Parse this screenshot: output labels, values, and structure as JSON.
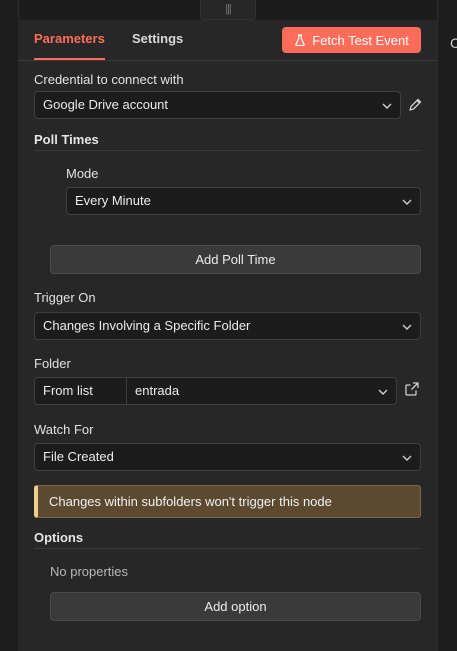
{
  "tabs": [
    {
      "label": "Parameters",
      "active": true
    },
    {
      "label": "Settings",
      "active": false
    }
  ],
  "fetch_button": {
    "label": "Fetch Test Event",
    "icon": "flask-icon",
    "color": "#ff6d5a"
  },
  "credential": {
    "label": "Credential to connect with",
    "value": "Google Drive account",
    "edit_icon": "pencil-icon"
  },
  "poll_times": {
    "title": "Poll Times",
    "mode_label": "Mode",
    "mode_value": "Every Minute",
    "add_button": "Add Poll Time"
  },
  "trigger_on": {
    "label": "Trigger On",
    "value": "Changes Involving a Specific Folder"
  },
  "folder": {
    "label": "Folder",
    "source": "From list",
    "value": "entrada",
    "open_icon": "external-link-icon"
  },
  "watch_for": {
    "label": "Watch For",
    "value": "File Created"
  },
  "notice": {
    "text": "Changes within subfolders won't trigger this node",
    "accent": "#f2cc8f"
  },
  "options": {
    "title": "Options",
    "empty_text": "No properties",
    "add_button": "Add option"
  },
  "right_panel_peek": "C"
}
